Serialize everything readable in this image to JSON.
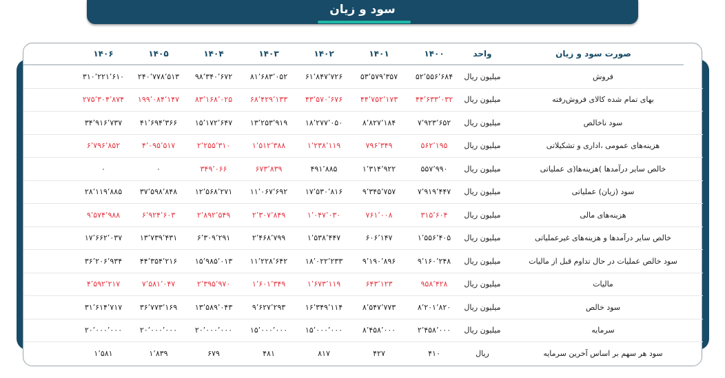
{
  "header": {
    "title": "سود و زیان"
  },
  "table": {
    "columns": {
      "label": "صورت سود و زیان",
      "unit": "واحد",
      "years": [
        "۱۴۰۰",
        "۱۴۰۱",
        "۱۴۰۲",
        "۱۴۰۳",
        "۱۴۰۴",
        "۱۴۰۵",
        "۱۴۰۶"
      ]
    },
    "rows": [
      {
        "label": "فروش",
        "unit": "میلیون ریال",
        "negative": false,
        "values": [
          "۵۲٬۵۵۶٬۶۸۴",
          "۵۳٬۵۷۹٬۳۵۷",
          "۶۱٬۸۴۷٬۷۲۶",
          "۸۱٬۶۸۳٬۰۵۲",
          "۹۸٬۳۴۰٬۶۷۲",
          "۲۴۰٬۷۷۸٬۵۱۳",
          "۳۱۰٬۲۲۱٬۶۱۰"
        ]
      },
      {
        "label": "بهای تمام شده کالای فروش‌رفته",
        "unit": "میلیون ریال",
        "negative": true,
        "values": [
          "۴۴٬۶۳۳٬۰۳۲",
          "۴۴٬۷۵۲٬۱۷۳",
          "۴۳٬۵۷۰٬۶۷۶",
          "۶۸٬۴۲۹٬۱۳۳",
          "۸۳٬۱۶۸٬۰۲۵",
          "۱۹۹٬۰۸۴٬۱۴۷",
          "۲۷۵٬۳۰۴٬۸۷۴"
        ]
      },
      {
        "label": "سود ناخالص",
        "unit": "میلیون ریال",
        "negative": false,
        "values": [
          "۷٬۹۲۳٬۶۵۲",
          "۸٬۸۲۷٬۱۸۴",
          "۱۸٬۲۷۷٬۰۵۰",
          "۱۳٬۲۵۳٬۹۱۹",
          "۱۵٬۱۷۲٬۶۴۷",
          "۴۱٬۶۹۴٬۳۶۶",
          "۳۴٬۹۱۶٬۷۳۷"
        ]
      },
      {
        "label": "هزینه‌های عمومی ،اداری و تشکیلاتی",
        "unit": "میلیون ریال",
        "negative": true,
        "values": [
          "۵۶۲٬۱۹۵",
          "۷۹۶٬۳۴۹",
          "۱٬۲۳۸٬۱۱۹",
          "۱٬۵۱۲٬۳۸۸",
          "۲٬۲۵۵٬۳۱۰",
          "۴٬۰۹۵٬۵۱۷",
          "۶٬۷۹۶٬۸۵۲"
        ]
      },
      {
        "label": "خالص سایر درآمدها )هزینه‌ها(ی عملیاتی",
        "unit": "میلیون ریال",
        "negative": false,
        "values": [
          "۵۵۷٬۹۹۰",
          "۱٬۳۱۴٬۹۲۲",
          "۴۹۱٬۸۸۵",
          "۶۷۳٬۸۳۹",
          "۳۴۹٬۰۶۶",
          "۰",
          "۰"
        ],
        "negIdx": [
          3,
          4
        ]
      },
      {
        "label": "سود (زیان) عملیاتی",
        "unit": "میلیون ریال",
        "negative": false,
        "values": [
          "۷٬۹۱۹٬۴۴۷",
          "۹٬۳۴۵٬۷۵۷",
          "۱۷٬۵۳۰٬۸۱۶",
          "۱۱٬۰۶۷٬۶۹۲",
          "۱۲٬۵۶۸٬۲۷۱",
          "۳۷٬۵۹۸٬۸۴۸",
          "۲۸٬۱۱۹٬۸۸۵"
        ]
      },
      {
        "label": "هزینه‌های مالی",
        "unit": "میلیون ریال",
        "negative": true,
        "values": [
          "۳۱۵٬۶۰۴",
          "۷۶۱٬۰۰۸",
          "۱٬۰۴۷٬۰۳۰",
          "۲٬۳۰۷٬۸۴۹",
          "۲٬۸۹۲٬۵۴۹",
          "۶٬۹۲۴٬۶۰۳",
          "۹٬۵۷۴٬۹۸۸"
        ]
      },
      {
        "label": "خالص سایر درآمدها و هزینه‌های غیرعملیاتی",
        "unit": "میلیون ریال",
        "negative": false,
        "values": [
          "۱٬۵۵۶٬۴۰۵",
          "۶۰۶٬۱۴۷",
          "۱٬۵۳۸٬۴۴۷",
          "۲٬۴۶۸٬۷۹۹",
          "۶٬۳۰۹٬۲۹۱",
          "۱۳٬۷۳۹٬۴۳۱",
          "۱۷٬۶۶۲٬۰۳۷"
        ]
      },
      {
        "label": "سود خالص عملیات در حال تداوم قبل از مالیات",
        "unit": "میلیون ریال",
        "negative": false,
        "values": [
          "۹٬۱۶۰٬۲۴۸",
          "۹٬۱۹۰٬۸۹۶",
          "۱۸٬۰۲۲٬۲۳۳",
          "۱۱٬۲۲۸٬۶۴۲",
          "۱۵٬۹۸۵٬۰۱۳",
          "۴۴٬۳۵۴٬۲۱۶",
          "۳۶٬۲۰۶٬۹۳۴"
        ]
      },
      {
        "label": "مالیات",
        "unit": "میلیون ریال",
        "negative": true,
        "values": [
          "۹۵۸٬۴۲۸",
          "۶۴۳٬۱۲۳",
          "۱٬۶۷۳٬۱۱۹",
          "۱٬۶۰۱٬۳۴۹",
          "۲٬۳۹۵٬۹۷۰",
          "۷٬۵۸۱٬۰۴۷",
          "۴٬۵۹۲٬۲۱۷"
        ]
      },
      {
        "label": "سود خالص",
        "unit": "میلیون ریال",
        "negative": false,
        "values": [
          "۸٬۲۰۱٬۸۲۰",
          "۸٬۵۴۷٬۷۷۳",
          "۱۶٬۳۴۹٬۱۱۴",
          "۹٬۶۲۷٬۲۹۳",
          "۱۳٬۵۸۹٬۰۴۳",
          "۳۶٬۷۷۳٬۱۶۹",
          "۳۱٬۶۱۴٬۷۱۷"
        ]
      },
      {
        "label": "سرمایه",
        "unit": "میلیون ریال",
        "negative": false,
        "values": [
          "۲٬۴۵۸٬۰۰۰",
          "۸٬۴۵۸٬۰۰۰",
          "۱۵٬۰۰۰٬۰۰۰",
          "۱۵٬۰۰۰٬۰۰۰",
          "۲۰٬۰۰۰٬۰۰۰",
          "۲۰٬۰۰۰٬۰۰۰",
          "۲۰٬۰۰۰٬۰۰۰"
        ]
      },
      {
        "label": "سود هر سهم بر اساس آخرین سرمایه",
        "unit": "ریال",
        "negative": false,
        "values": [
          "۴۱۰",
          "۴۲۷",
          "۸۱۷",
          "۴۸۱",
          "۶۷۹",
          "۱٬۸۳۹",
          "۱٬۵۸۱"
        ]
      }
    ]
  },
  "colors": {
    "header_bg": "#184b67",
    "accent": "#1fb9a6",
    "negative": "#e3343f"
  }
}
